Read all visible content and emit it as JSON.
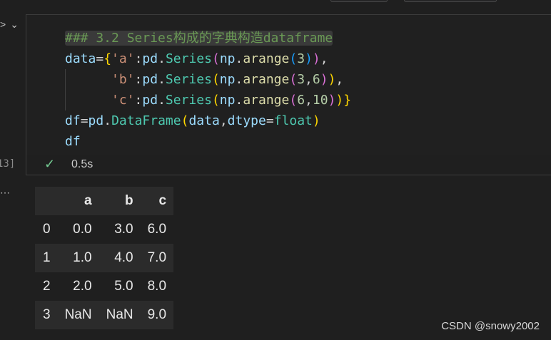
{
  "cell": {
    "exec_count": "13]",
    "duration": "0.5s",
    "status_icon": "check-icon"
  },
  "code_lines": [
    "### 3.2 Series构成的字典构造dataframe",
    "data={'a':pd.Series(np.arange(3)),",
    "      'b':pd.Series(np.arange(3,6)),",
    "      'c':pd.Series(np.arange(6,10))}",
    "df=pd.DataFrame(data,dtype=float)",
    "df"
  ],
  "output": {
    "ellipsis": "⋯",
    "columns": [
      "",
      "a",
      "b",
      "c"
    ],
    "rows": [
      {
        "index": "0",
        "a": "0.0",
        "b": "3.0",
        "c": "6.0"
      },
      {
        "index": "1",
        "a": "1.0",
        "b": "4.0",
        "c": "7.0"
      },
      {
        "index": "2",
        "a": "2.0",
        "b": "5.0",
        "c": "8.0"
      },
      {
        "index": "3",
        "a": "NaN",
        "b": "NaN",
        "c": "9.0"
      }
    ]
  },
  "watermark": "CSDN @snowy2002",
  "colors": {
    "background": "#1f1f1f",
    "comment": "#6a9955",
    "check": "#73c991"
  }
}
